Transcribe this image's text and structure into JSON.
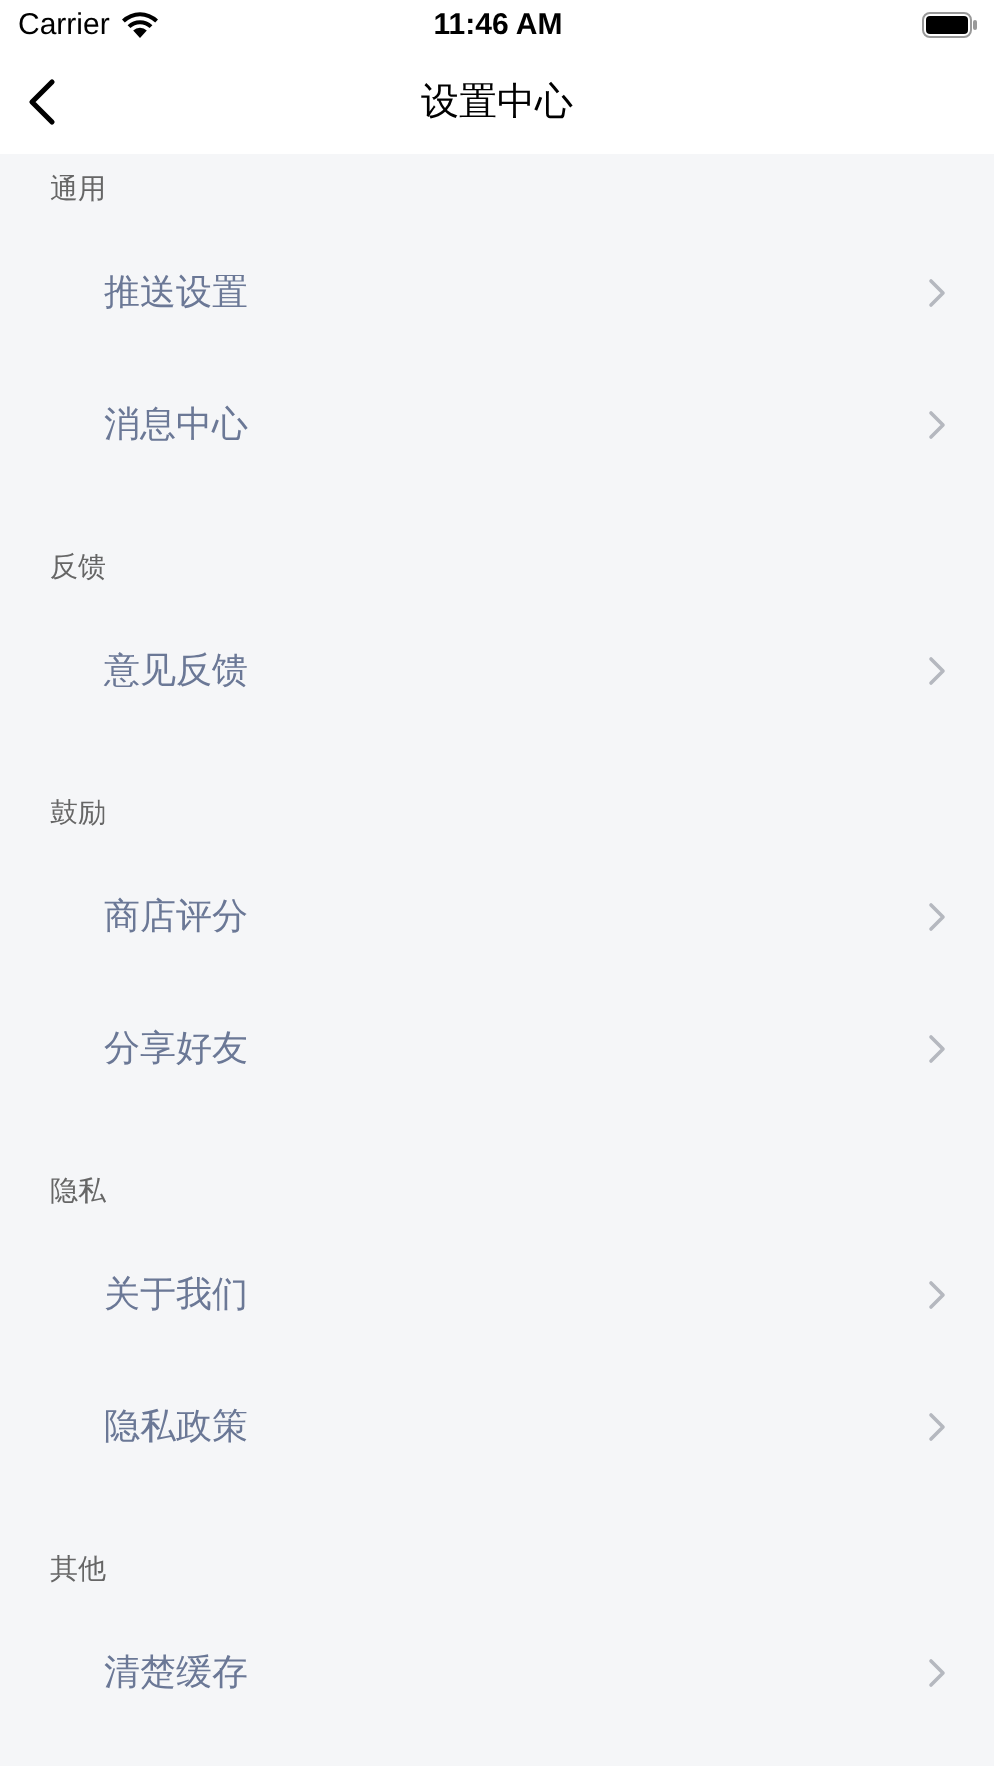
{
  "status_bar": {
    "carrier": "Carrier",
    "time": "11:46 AM"
  },
  "nav": {
    "title": "设置中心"
  },
  "sections": [
    {
      "title": "通用",
      "items": [
        {
          "label": "推送设置"
        },
        {
          "label": "消息中心"
        }
      ]
    },
    {
      "title": "反馈",
      "items": [
        {
          "label": "意见反馈"
        }
      ]
    },
    {
      "title": "鼓励",
      "items": [
        {
          "label": "商店评分"
        },
        {
          "label": "分享好友"
        }
      ]
    },
    {
      "title": "隐私",
      "items": [
        {
          "label": "关于我们"
        },
        {
          "label": "隐私政策"
        }
      ]
    },
    {
      "title": "其他",
      "items": [
        {
          "label": "清楚缓存"
        }
      ]
    }
  ]
}
